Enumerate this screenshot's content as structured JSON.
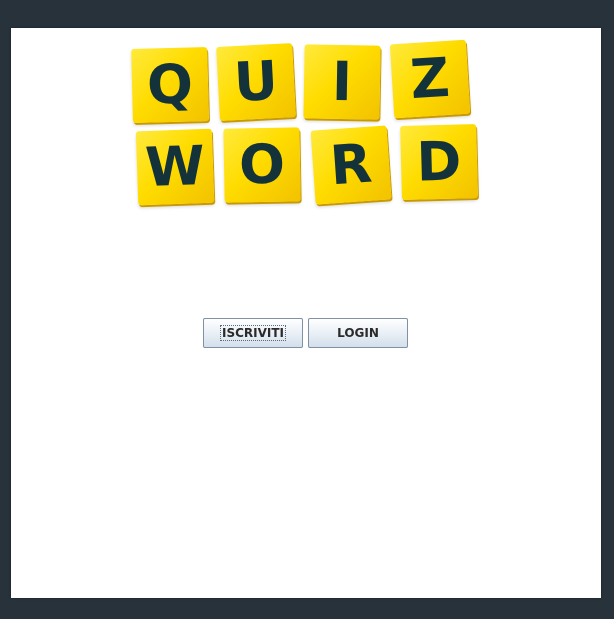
{
  "logo": {
    "row1": [
      "Q",
      "U",
      "I",
      "Z"
    ],
    "row2": [
      "W",
      "O",
      "R",
      "D"
    ]
  },
  "buttons": {
    "signup_label": "ISCRIVITI",
    "login_label": "LOGIN"
  },
  "colors": {
    "background": "#27323a",
    "panel": "#ffffff",
    "tile": "#ffdc00",
    "tile_text": "#14323a"
  }
}
